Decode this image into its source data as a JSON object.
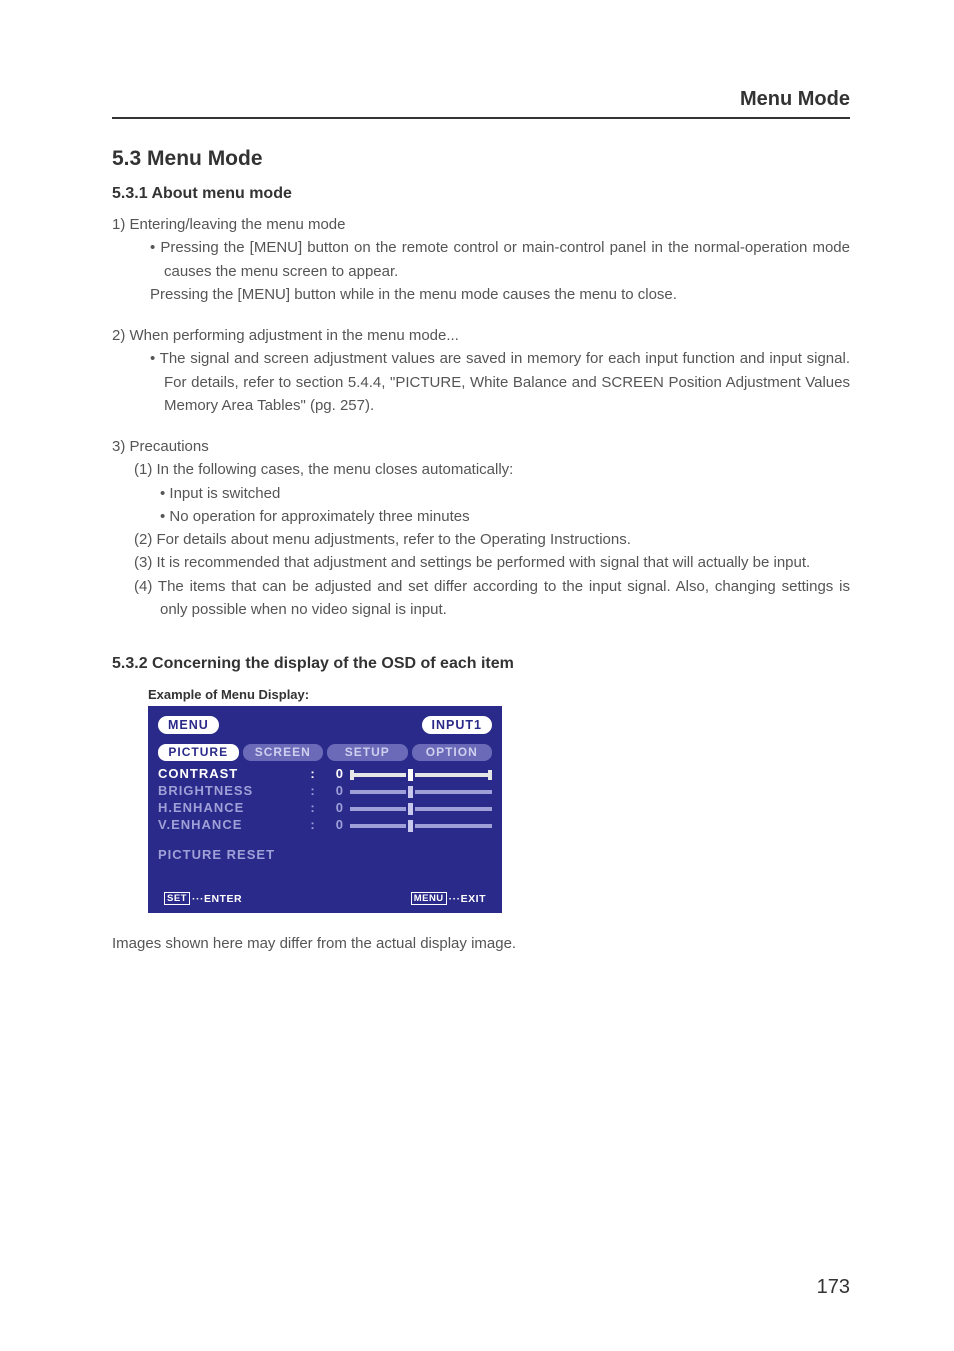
{
  "header": {
    "right": "Menu Mode"
  },
  "section": {
    "title": "5.3 Menu Mode"
  },
  "sub1": {
    "title": "5.3.1 About menu mode",
    "item1": {
      "num": "1)",
      "lead": "Entering/leaving the menu mode",
      "b1a": "• Pressing the [MENU] button on the remote control or main-control panel in the normal-operation mode causes the menu screen to appear.",
      "b1b": "Pressing the [MENU] button while in the menu mode causes the menu to close."
    },
    "item2": {
      "num": "2)",
      "lead": "When performing adjustment in the menu mode...",
      "b1": "• The signal and screen adjustment values are saved in memory for each input function and input signal. For details, refer to section 5.4.4, \"PICTURE, White Balance and SCREEN Position Adjustment Values Memory Area Tables\" (pg. 257)."
    },
    "item3": {
      "num": "3)",
      "lead": "Precautions",
      "p1": "(1) In the following cases, the menu closes automatically:",
      "p1a": "• Input is switched",
      "p1b": "• No operation for approximately three minutes",
      "p2": "(2) For details about menu adjustments, refer to the Operating Instructions.",
      "p3": "(3) It is recommended that adjustment and settings be performed with signal that will actually be input.",
      "p4": "(4) The items that can be adjusted and set differ according to the input signal. Also, changing settings is only possible when no video signal is input."
    }
  },
  "sub2": {
    "title": "5.3.2 Concerning the display of the OSD of each item",
    "caption": "Example of Menu Display:",
    "note": "Images shown here may differ from the actual display image."
  },
  "osd": {
    "menu": "MENU",
    "input": "INPUT1",
    "tabs": {
      "t1": "PICTURE",
      "t2": "SCREEN",
      "t3": "SETUP",
      "t4": "OPTION"
    },
    "rows": {
      "r1": {
        "label": "CONTRAST",
        "val": "0"
      },
      "r2": {
        "label": "BRIGHTNESS",
        "val": "0"
      },
      "r3": {
        "label": "H.ENHANCE",
        "val": "0"
      },
      "r4": {
        "label": "V.ENHANCE",
        "val": "0"
      }
    },
    "reset": "PICTURE RESET",
    "footer": {
      "left_key": "SET",
      "left_txt": "···ENTER",
      "right_key": "MENU",
      "right_txt": "···EXIT"
    }
  },
  "page_number": "173"
}
